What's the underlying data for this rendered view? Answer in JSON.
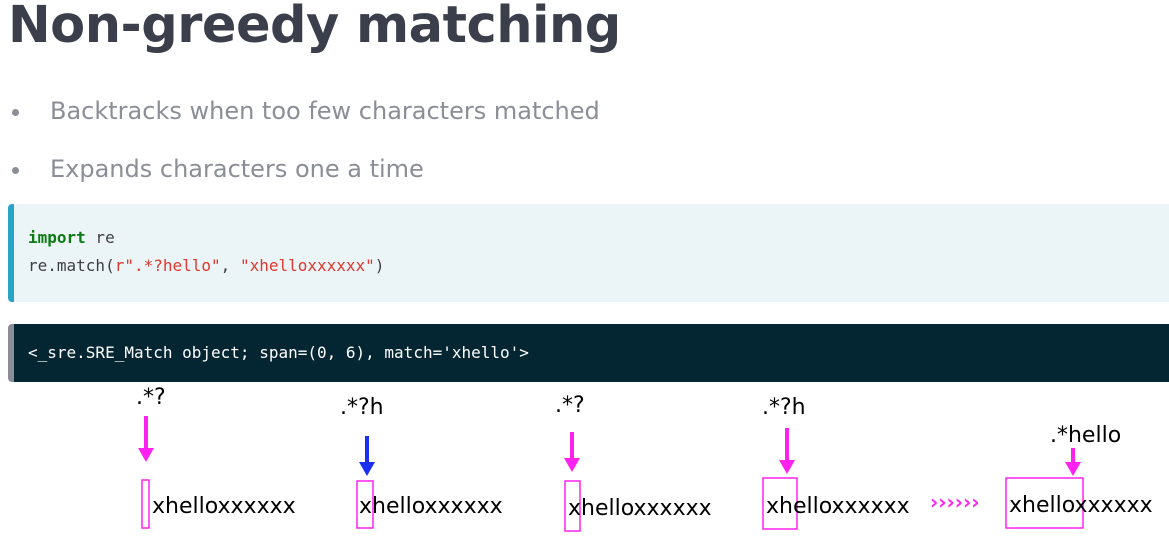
{
  "title": "Non-greedy matching",
  "bullets": [
    "Backtracks when too few characters matched",
    "Expands characters one a time"
  ],
  "code_input": {
    "line1": {
      "keyword": "import",
      "rest": " re"
    },
    "line2": {
      "prefix": "re.match(",
      "pattern": "r\".*?hello\"",
      "sep": ", ",
      "subject": "\"xhelloxxxxxx\"",
      "suffix": ")"
    }
  },
  "code_output": "<_sre.SRE_Match object; span=(0, 6), match='xhello'>",
  "diagram": {
    "steps": [
      {
        "label": ".*?",
        "text": "xhelloxxxxxx",
        "arrow_color": "#ff22ee"
      },
      {
        "label": ".*?h",
        "text": "xhelloxxxxxx",
        "arrow_color": "#1a2ff0"
      },
      {
        "label": ".*?",
        "text": "xhelloxxxxxx",
        "arrow_color": "#ff22ee"
      },
      {
        "label": ".*?h",
        "text": "xhelloxxxxxx",
        "arrow_color": "#ff22ee"
      },
      {
        "label": ".*hello",
        "text": "xhelloxxxxxx",
        "arrow_color": "#ff22ee"
      }
    ],
    "chevrons": "››››››",
    "highlight_color": "#ff22ee"
  }
}
